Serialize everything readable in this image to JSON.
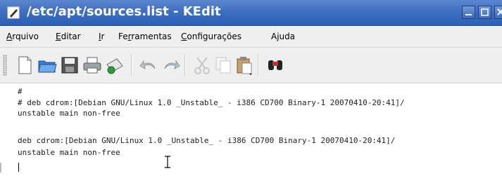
{
  "window": {
    "title": "/etc/apt/sources.list - KEdit"
  },
  "menu": [
    {
      "label": "Arquivo",
      "accel": "A"
    },
    {
      "label": "Editar",
      "accel": "E"
    },
    {
      "label": "Ir",
      "accel": "I"
    },
    {
      "label": "Ferramentas",
      "accel": "r"
    },
    {
      "label": "Configurações",
      "accel": "C"
    },
    {
      "label": "Ajuda",
      "accel": ""
    }
  ],
  "toolbar": [
    {
      "icon": "new-document-icon"
    },
    {
      "icon": "open-folder-icon"
    },
    {
      "icon": "save-icon"
    },
    {
      "icon": "print-icon"
    },
    {
      "icon": "send-mail-icon"
    },
    {
      "icon": "undo-icon"
    },
    {
      "icon": "redo-icon"
    },
    {
      "icon": "cut-icon"
    },
    {
      "icon": "copy-icon"
    },
    {
      "icon": "paste-icon"
    },
    {
      "icon": "find-icon"
    }
  ],
  "editor": {
    "lines": [
      "#",
      "# deb cdrom:[Debian GNU/Linux 1.0 _Unstable_ - i386 CD700 Binary-1 20070410-20:41]/",
      "unstable main non-free",
      "",
      "deb cdrom:[Debian GNU/Linux 1.0 _Unstable_ - i386 CD700 Binary-1 20070410-20:41]/",
      "unstable main non-free",
      ""
    ]
  },
  "colors": {
    "titlebar": "#3f6fc0",
    "menubar": "#efefef"
  }
}
